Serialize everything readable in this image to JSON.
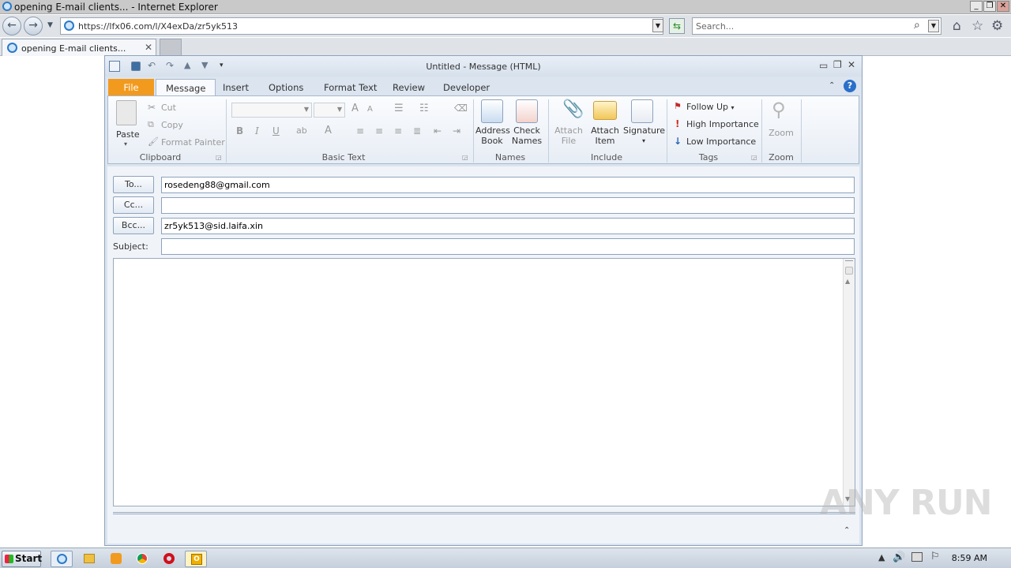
{
  "browser": {
    "window_title": "opening E-mail clients... - Internet Explorer",
    "url": "https://lfx06.com/l/X4exDa/zr5yk513",
    "search_placeholder": "Search...",
    "tab_title": "opening E-mail clients..."
  },
  "outlook": {
    "title": "Untitled  -  Message (HTML)",
    "tabs": [
      "File",
      "Message",
      "Insert",
      "Options",
      "Format Text",
      "Review",
      "Developer"
    ],
    "clipboard": {
      "paste": "Paste",
      "cut": "Cut",
      "copy": "Copy",
      "format_painter": "Format Painter",
      "label": "Clipboard"
    },
    "basic_text_label": "Basic Text",
    "names": {
      "address_book": [
        "Address",
        "Book"
      ],
      "check_names": [
        "Check",
        "Names"
      ],
      "label": "Names"
    },
    "include": {
      "attach_file": [
        "Attach",
        "File"
      ],
      "attach_item": [
        "Attach",
        "Item"
      ],
      "signature": "Signature",
      "label": "Include"
    },
    "tags": {
      "follow_up": "Follow Up",
      "high_importance": "High Importance",
      "low_importance": "Low Importance",
      "label": "Tags"
    },
    "zoom": {
      "button": "Zoom",
      "label": "Zoom"
    },
    "form": {
      "to_button": "To...",
      "to_value": "rosedeng88@gmail.com",
      "cc_button": "Cc...",
      "cc_value": "",
      "bcc_button": "Bcc...",
      "bcc_value": "zr5yk513@sid.laifa.xin",
      "subject_label": "Subject:",
      "subject_value": ""
    }
  },
  "taskbar": {
    "start": "Start",
    "clock": "8:59 AM"
  },
  "watermark": "ANY RUN",
  "colors": {
    "file_tab": "#f29a1e",
    "ribbon_bg": "#dbe4ef"
  }
}
